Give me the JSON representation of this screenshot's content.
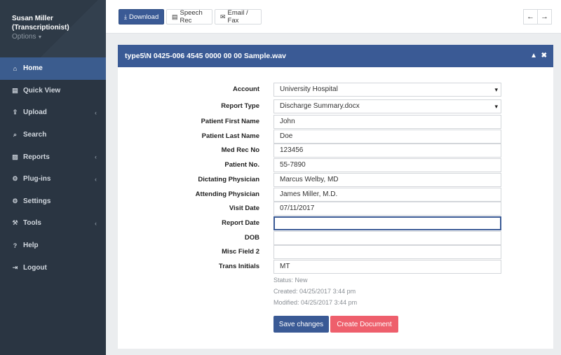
{
  "profile": {
    "name": "Susan Miller",
    "role": "(Transcriptionist)",
    "options": "Options"
  },
  "nav": [
    {
      "label": "Home",
      "icon": "home-icon",
      "glyph": "⌂"
    },
    {
      "label": "Quick View",
      "icon": "file-icon",
      "glyph": "▤"
    },
    {
      "label": "Upload",
      "icon": "upload-icon",
      "glyph": "⇪"
    },
    {
      "label": "Search",
      "icon": "search-icon",
      "glyph": "⌕"
    },
    {
      "label": "Reports",
      "icon": "reports-icon",
      "glyph": "▨"
    },
    {
      "label": "Plug-ins",
      "icon": "plugins-icon",
      "glyph": "⚙"
    },
    {
      "label": "Settings",
      "icon": "gear-icon",
      "glyph": "⚙"
    },
    {
      "label": "Tools",
      "icon": "wrench-icon",
      "glyph": "⚒"
    },
    {
      "label": "Help",
      "icon": "help-icon",
      "glyph": "?"
    },
    {
      "label": "Logout",
      "icon": "logout-icon",
      "glyph": "⇥"
    }
  ],
  "toolbar": {
    "download": "Download",
    "speech": "Speech Rec",
    "email": "Email / Fax"
  },
  "panel": {
    "title": "type5\\N 0425-006 4545 0000 00 00 Sample.wav"
  },
  "form": {
    "account": {
      "label": "Account",
      "value": "University Hospital"
    },
    "report_type": {
      "label": "Report Type",
      "value": "Discharge Summary.docx"
    },
    "first_name": {
      "label": "Patient First Name",
      "value": "John"
    },
    "last_name": {
      "label": "Patient Last Name",
      "value": "Doe"
    },
    "med_rec": {
      "label": "Med Rec No",
      "value": "123456"
    },
    "patient_no": {
      "label": "Patient No.",
      "value": "55-7890"
    },
    "dictating": {
      "label": "Dictating Physician",
      "value": "Marcus Welby, MD"
    },
    "attending": {
      "label": "Attending Physician",
      "value": "James Miller, M.D."
    },
    "visit_date": {
      "label": "Visit Date",
      "value": "07/11/2017"
    },
    "report_date": {
      "label": "Report Date",
      "value": ""
    },
    "dob": {
      "label": "DOB",
      "value": ""
    },
    "misc2": {
      "label": "Misc Field 2",
      "value": ""
    },
    "trans_initials": {
      "label": "Trans Initials",
      "value": "MT"
    }
  },
  "status": {
    "status": "Status: New",
    "created": "Created: 04/25/2017 3:44 pm",
    "modified": "Modified: 04/25/2017 3:44 pm"
  },
  "actions": {
    "save": "Save changes",
    "create": "Create Document"
  }
}
